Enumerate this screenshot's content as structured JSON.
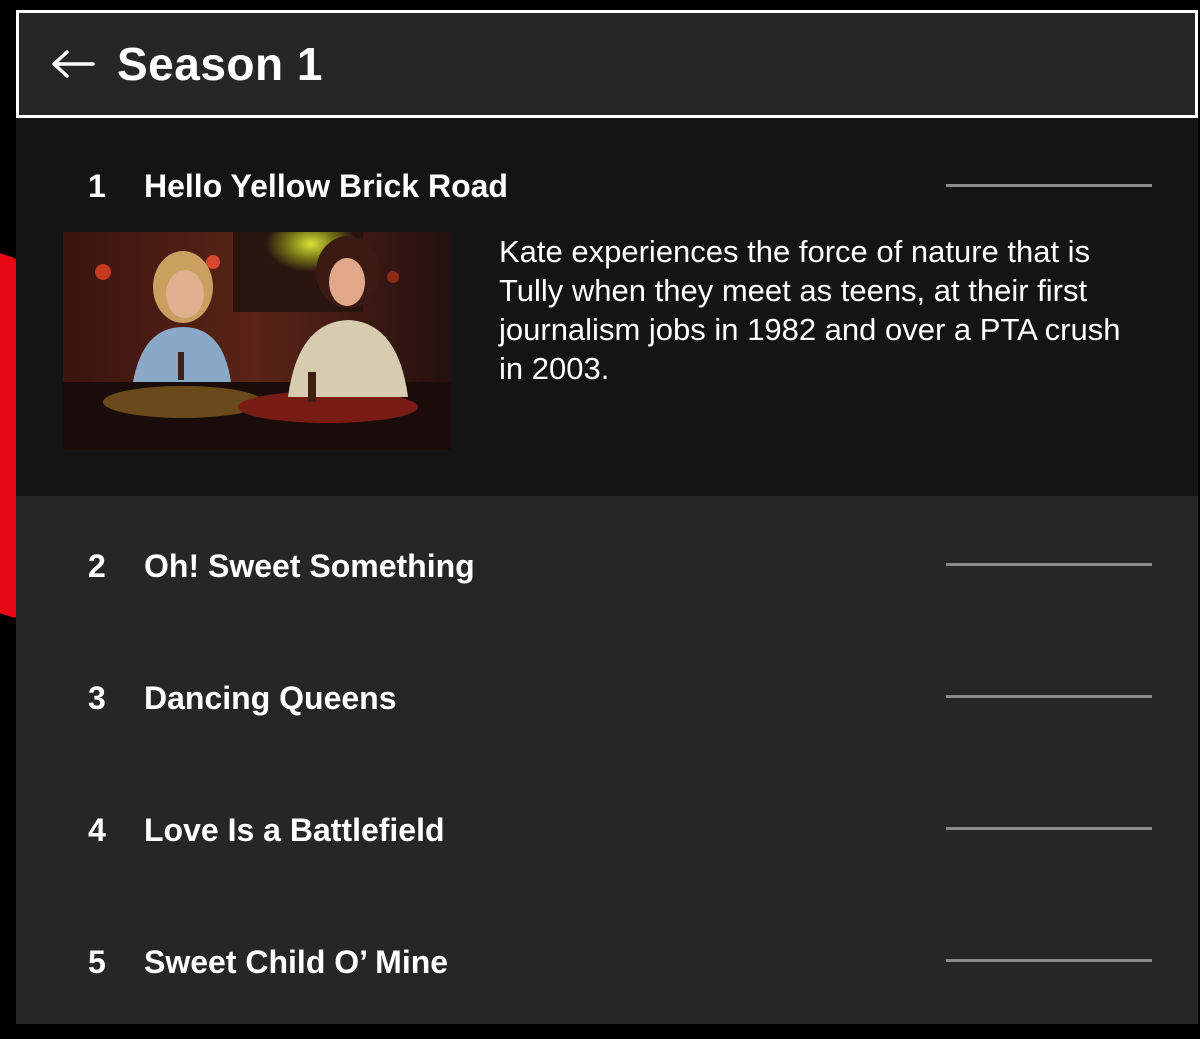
{
  "header": {
    "back_icon": "arrow-left-icon",
    "title": "Season 1"
  },
  "episodes": [
    {
      "number": "1",
      "title": "Hello Yellow Brick Road",
      "description": "Kate experiences the force of nature that is Tully when they meet as teens, at their first journalism jobs in 1982 and over a PTA crush in 2003.",
      "expanded": true,
      "progress": 0
    },
    {
      "number": "2",
      "title": "Oh! Sweet Something",
      "progress": 0
    },
    {
      "number": "3",
      "title": "Dancing Queens",
      "progress": 0
    },
    {
      "number": "4",
      "title": "Love Is a Battlefield",
      "progress": 0
    },
    {
      "number": "5",
      "title": "Sweet Child O’ Mine",
      "progress": 0
    }
  ],
  "colors": {
    "panel": "#262626",
    "expanded_row": "#141414",
    "progress_track": "#8a8a8a",
    "accent": "#e50914"
  }
}
